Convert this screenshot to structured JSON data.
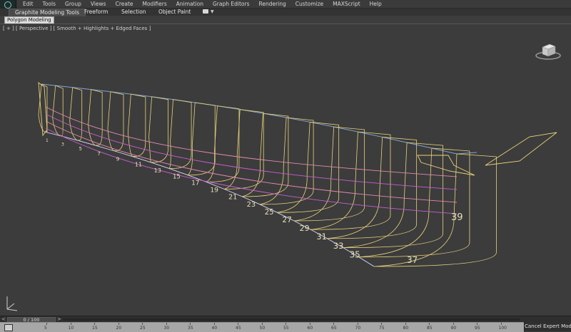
{
  "menubar": {
    "items": [
      "Edit",
      "Tools",
      "Group",
      "Views",
      "Create",
      "Modifiers",
      "Animation",
      "Graph Editors",
      "Rendering",
      "Customize",
      "MAXScript",
      "Help"
    ]
  },
  "ribbon": {
    "tabs": [
      "Graphite Modeling Tools",
      "Freeform",
      "Selection",
      "Object Paint"
    ],
    "panel_label": "Polygon Modeling"
  },
  "viewport": {
    "label": "[ + ] [ Perspective ] [ Smooth + Highlights + Edged Faces ]",
    "station_labels": [
      "1",
      "3",
      "5",
      "7",
      "9",
      "11",
      "13",
      "15",
      "17",
      "19",
      "21",
      "23",
      "25",
      "27",
      "29",
      "31",
      "33",
      "35",
      "37",
      "39"
    ]
  },
  "timeslider": {
    "frame_text": "0 / 100",
    "left_arrow": "<",
    "right_arrow": ">"
  },
  "trackbar": {
    "numbers": [
      "5",
      "10",
      "15",
      "20",
      "25",
      "30",
      "35",
      "40",
      "45",
      "50",
      "55",
      "60",
      "65",
      "70",
      "75",
      "80",
      "85",
      "90",
      "95",
      "100"
    ]
  },
  "status": {
    "expert_mode_button": "Cancel Expert Mode"
  },
  "colors": {
    "section_lines": "#e8d27a",
    "waterline_pink": "#e38ab0",
    "waterline_magenta": "#c85fd0",
    "sheer_line": "#7fa6d8",
    "keel_line": "#d8d8ff",
    "labels": "#e6e0b8"
  }
}
